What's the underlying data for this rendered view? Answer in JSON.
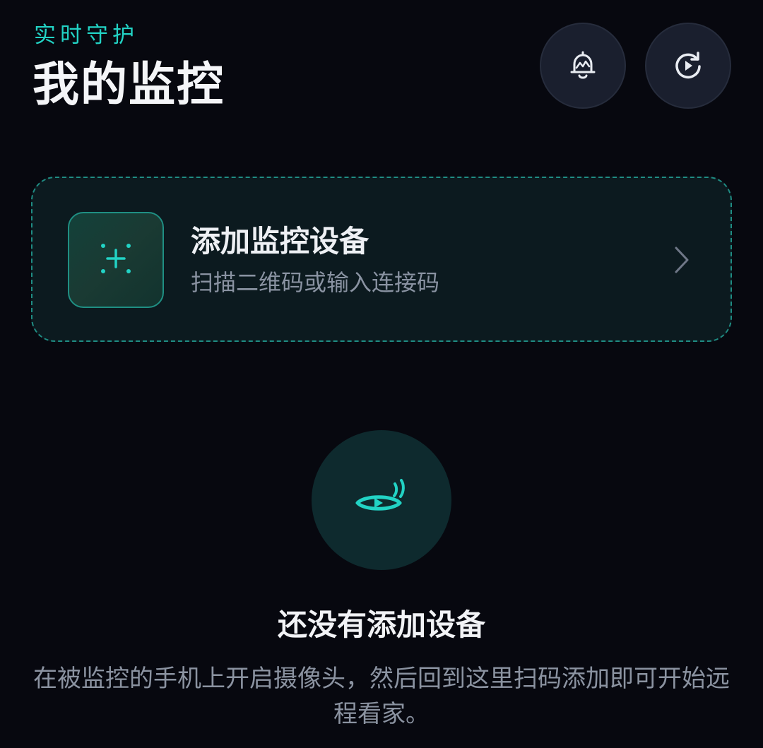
{
  "header": {
    "eyebrow": "实时守护",
    "title": "我的监控",
    "buttons": [
      {
        "icon": "bell-alert-icon"
      },
      {
        "icon": "replay-icon"
      }
    ]
  },
  "add_device": {
    "title": "添加监控设备",
    "subtitle": "扫描二维码或输入连接码",
    "icon": "scan-plus-icon",
    "chevron_icon": "chevron-right-icon"
  },
  "empty_state": {
    "icon": "eye-signal-icon",
    "title": "还没有添加设备",
    "description": "在被监控的手机上开启摄像头，然后回到这里扫码添加即可开始远程看家。"
  },
  "colors": {
    "background": "#07080f",
    "accent": "#22d3c5",
    "card_background": "#0c1a1f",
    "button_background": "#1a1f2e"
  }
}
